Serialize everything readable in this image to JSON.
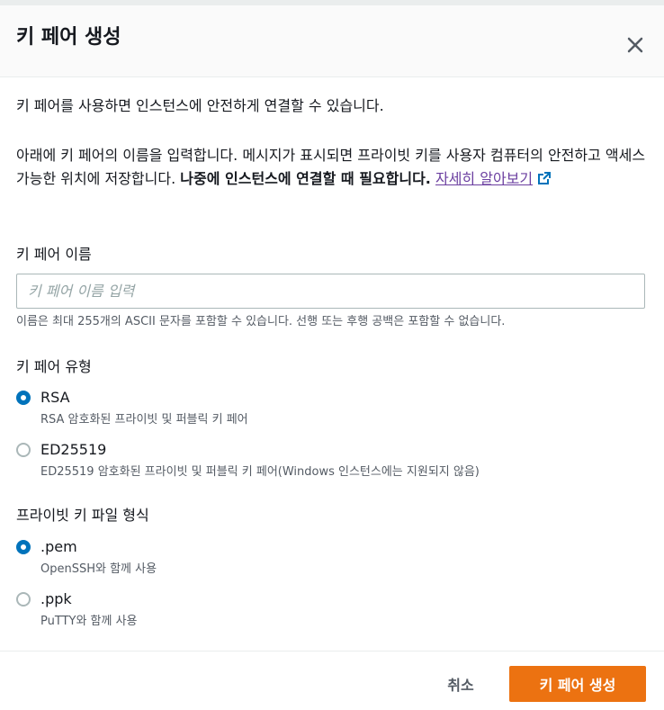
{
  "dialog": {
    "title": "키 페어 생성",
    "intro": "키 페어를 사용하면 인스턴스에 안전하게 연결할 수 있습니다.",
    "description_part1": "아래에 키 페어의 이름을 입력합니다. 메시지가 표시되면 프라이빗 키를 사용자 컴퓨터의 안전하고 액세스 가능한 위치에 저장합니다.",
    "description_bold": "나중에 인스턴스에 연결할 때 필요합니다.",
    "learn_more_link": "자세히 알아보기"
  },
  "key_name": {
    "label": "키 페어 이름",
    "value": "",
    "placeholder": "키 페어 이름 입력",
    "hint": "이름은 최대 255개의 ASCII 문자를 포함할 수 있습니다. 선행 또는 후행 공백은 포함할 수 없습니다."
  },
  "key_type": {
    "label": "키 페어 유형",
    "options": [
      {
        "label": "RSA",
        "description": "RSA 암호화된 프라이빗 및 퍼블릭 키 페어",
        "selected": true
      },
      {
        "label": "ED25519",
        "description": "ED25519 암호화된 프라이빗 및 퍼블릭 키 페어(Windows 인스턴스에는 지원되지 않음)",
        "selected": false
      }
    ]
  },
  "file_format": {
    "label": "프라이빗 키 파일 형식",
    "options": [
      {
        "label": ".pem",
        "description": "OpenSSH와 함께 사용",
        "selected": true
      },
      {
        "label": ".ppk",
        "description": "PuTTY와 함께 사용",
        "selected": false
      }
    ]
  },
  "footer": {
    "cancel_label": "취소",
    "create_label": "키 페어 생성"
  },
  "colors": {
    "accent": "#0073bb",
    "primary_button": "#ec7211",
    "link": "#6b3fa0"
  },
  "icons": {
    "close": "close-icon",
    "external_link": "external-link-icon"
  }
}
